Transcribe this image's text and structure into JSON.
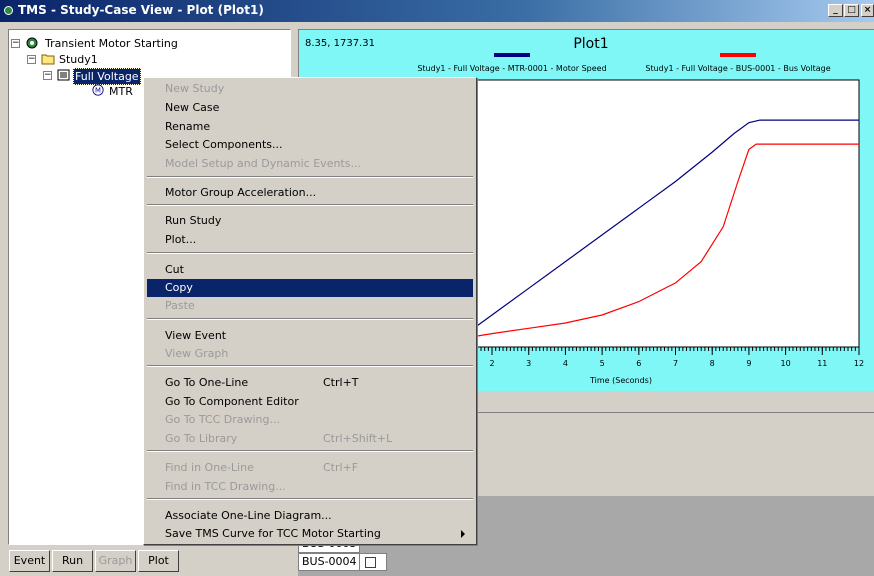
{
  "window": {
    "title": "TMS - Study-Case View - Plot (Plot1)",
    "min_label": "_",
    "max_label": "□",
    "close_label": "×"
  },
  "tree": {
    "root": "Transient Motor Starting",
    "study": "Study1",
    "case": "Full Voltage",
    "component": "MTR"
  },
  "buttons": {
    "event": "Event",
    "run": "Run",
    "graph": "Graph",
    "plot": "Plot"
  },
  "plot": {
    "coords": "8.35, 1737.31",
    "title": "Plot1",
    "legend": [
      {
        "label": "Study1 - Full Voltage - MTR-0001 - Motor Speed",
        "color": "#000080"
      },
      {
        "label": "Study1 - Full Voltage - BUS-0001 - Bus Voltage",
        "color": "#ff0000"
      }
    ],
    "xlabel": "Time (Seconds)",
    "xticks": [
      "2",
      "3",
      "4",
      "5",
      "6",
      "7",
      "8",
      "9",
      "10",
      "11",
      "12"
    ]
  },
  "chart_data": {
    "type": "line",
    "title": "Plot1",
    "xlabel": "Time (Seconds)",
    "ylabel": "",
    "xlim": [
      1.1,
      12
    ],
    "ylim": [
      0,
      1
    ],
    "grid": false,
    "legend_position": "top",
    "series": [
      {
        "name": "Study1 - Full Voltage - MTR-0001 - Motor Speed",
        "color": "#000080",
        "x": [
          1.1,
          2,
          3,
          4,
          5,
          6,
          7,
          8,
          8.6,
          9,
          9.3,
          10,
          11,
          12
        ],
        "y": [
          0.03,
          0.12,
          0.22,
          0.32,
          0.42,
          0.52,
          0.62,
          0.73,
          0.8,
          0.84,
          0.85,
          0.85,
          0.85,
          0.85
        ]
      },
      {
        "name": "Study1 - Full Voltage - BUS-0001 - Bus Voltage",
        "color": "#ff0000",
        "x": [
          1.1,
          2,
          3,
          4,
          5,
          6,
          7,
          7.7,
          8.3,
          8.7,
          9.0,
          9.2,
          10,
          11,
          12
        ],
        "y": [
          0.03,
          0.05,
          0.07,
          0.09,
          0.12,
          0.17,
          0.24,
          0.32,
          0.45,
          0.62,
          0.74,
          0.76,
          0.76,
          0.76,
          0.76
        ]
      }
    ]
  },
  "grid": {
    "visible_row": "BUS-0004",
    "partial_row": "BUS-0003"
  },
  "context_menu": {
    "items": [
      {
        "label": "New Study",
        "enabled": false
      },
      {
        "label": "New Case",
        "enabled": true
      },
      {
        "label": "Rename",
        "enabled": true
      },
      {
        "label": "Select Components...",
        "enabled": true
      },
      {
        "label": "Model Setup and Dynamic Events...",
        "enabled": false
      },
      {
        "label": "Motor Group Acceleration...",
        "enabled": true
      },
      {
        "label": "Run Study",
        "enabled": true
      },
      {
        "label": "Plot...",
        "enabled": true
      },
      {
        "label": "Cut",
        "enabled": true
      },
      {
        "label": "Copy",
        "enabled": true,
        "highlighted": true
      },
      {
        "label": "Paste",
        "enabled": false
      },
      {
        "label": "View Event",
        "enabled": true
      },
      {
        "label": "View Graph",
        "enabled": false
      },
      {
        "label": "Go To One-Line",
        "shortcut": "Ctrl+T",
        "enabled": true
      },
      {
        "label": "Go To Component Editor",
        "enabled": true
      },
      {
        "label": "Go To TCC Drawing...",
        "enabled": false
      },
      {
        "label": "Go To Library",
        "shortcut": "Ctrl+Shift+L",
        "enabled": false
      },
      {
        "label": "Find in One-Line",
        "shortcut": "Ctrl+F",
        "enabled": false
      },
      {
        "label": "Find in TCC Drawing...",
        "enabled": false
      },
      {
        "label": "Associate One-Line Diagram...",
        "enabled": true
      },
      {
        "label": "Save TMS Curve for TCC Motor Starting",
        "enabled": true,
        "submenu": true
      }
    ]
  }
}
